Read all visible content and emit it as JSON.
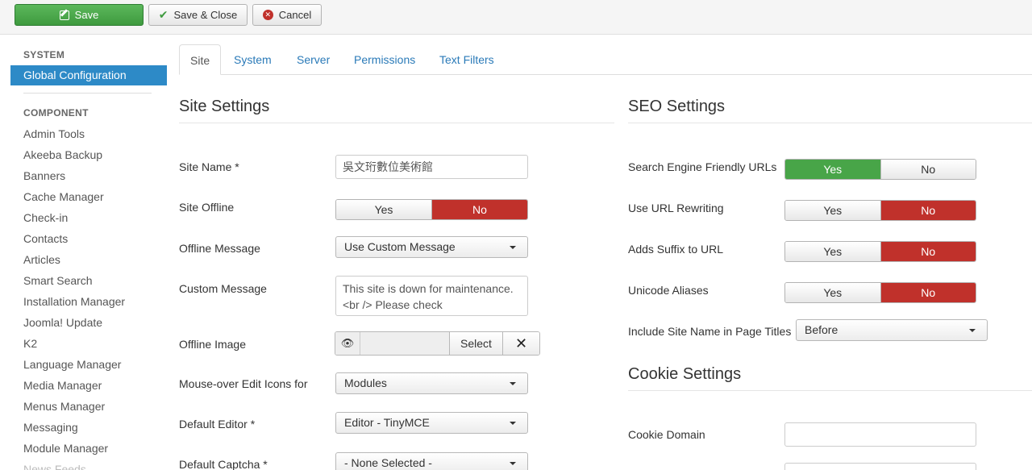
{
  "toolbar": {
    "save_label": "Save",
    "save_close_label": "Save & Close",
    "cancel_label": "Cancel"
  },
  "sidebar": {
    "system_header": "SYSTEM",
    "active_item": "Global Configuration",
    "component_header": "COMPONENT",
    "items": [
      "Admin Tools",
      "Akeeba Backup",
      "Banners",
      "Cache Manager",
      "Check-in",
      "Contacts",
      "Articles",
      "Smart Search",
      "Installation Manager",
      "Joomla! Update",
      "K2",
      "Language Manager",
      "Media Manager",
      "Menus Manager",
      "Messaging",
      "Module Manager",
      "News Feeds"
    ]
  },
  "tabs": [
    "Site",
    "System",
    "Server",
    "Permissions",
    "Text Filters"
  ],
  "site": {
    "title": "Site Settings",
    "site_name_label": "Site Name *",
    "site_name_value": "吳文珩數位美術館",
    "offline_label": "Site Offline",
    "offline_yes": "Yes",
    "offline_no": "No",
    "offline_message_label": "Offline Message",
    "offline_message_value": "Use Custom Message",
    "custom_message_label": "Custom Message",
    "custom_message_value": "This site is down for maintenance.<br /> Please check",
    "offline_image_label": "Offline Image",
    "offline_image_select": "Select",
    "mouseover_label": "Mouse-over Edit Icons for",
    "mouseover_value": "Modules",
    "editor_label": "Default Editor *",
    "editor_value": "Editor - TinyMCE",
    "captcha_label": "Default Captcha *",
    "captcha_value": "- None Selected -"
  },
  "seo": {
    "title": "SEO Settings",
    "sef_label": "Search Engine Friendly URLs",
    "rewrite_label": "Use URL Rewriting",
    "suffix_label": "Adds Suffix to URL",
    "unicode_label": "Unicode Aliases",
    "sitename_label": "Include Site Name in Page Titles",
    "sitename_value": "Before",
    "yes": "Yes",
    "no": "No"
  },
  "cookie": {
    "title": "Cookie Settings",
    "domain_label": "Cookie Domain"
  },
  "colors": {
    "accent": "#2d8ac7",
    "green": "#48a548",
    "red": "#c0312b"
  }
}
